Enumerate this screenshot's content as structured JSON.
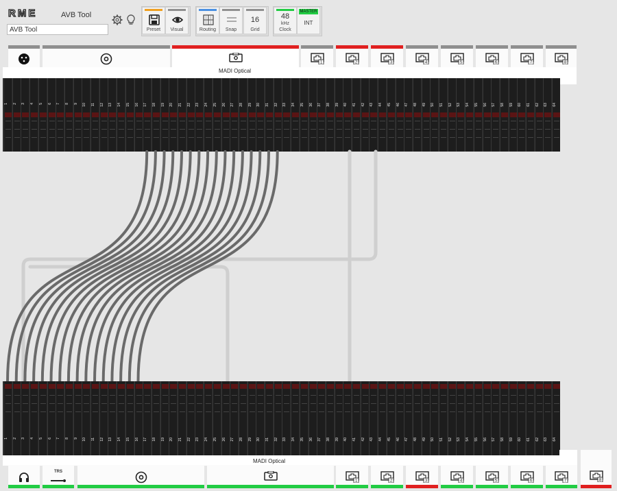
{
  "app": {
    "logo_text": "RME",
    "title": "AVB Tool",
    "device_name": "AVB Tool"
  },
  "toolbar": {
    "preset": {
      "label": "Preset",
      "color": "#f0a020"
    },
    "visual": {
      "label": "Visual",
      "color": "#909090"
    },
    "routing": {
      "label": "Routing",
      "color": "#4a90e2"
    },
    "snap": {
      "label": "Snap",
      "color": "#909090"
    },
    "grid": {
      "label": "Grid",
      "value": "16",
      "color": "#909090"
    },
    "clock": {
      "label": "Clock",
      "value": "48",
      "unit": "kHz",
      "color": "#22cc44"
    },
    "master": {
      "badge": "MASTER",
      "value": "INT",
      "color": "#22cc44"
    }
  },
  "top_tabs": [
    {
      "icon": "xlr-icon",
      "status": "#8f8f8f"
    },
    {
      "icon": "coax-icon",
      "status": "#8f8f8f"
    },
    {
      "icon": "optical-icon",
      "status": "#e02020",
      "selected": true
    },
    {
      "icon": "network-icon",
      "num": "1",
      "status": "#8f8f8f"
    },
    {
      "icon": "network-icon",
      "num": "2",
      "status": "#e02020"
    },
    {
      "icon": "network-icon",
      "num": "3",
      "status": "#e02020"
    },
    {
      "icon": "network-icon",
      "num": "4",
      "status": "#8f8f8f"
    },
    {
      "icon": "network-icon",
      "num": "5",
      "status": "#8f8f8f"
    },
    {
      "icon": "network-icon",
      "num": "6",
      "status": "#8f8f8f"
    },
    {
      "icon": "network-icon",
      "num": "7",
      "status": "#8f8f8f"
    },
    {
      "icon": "network-icon",
      "num": "8",
      "status": "#8f8f8f"
    }
  ],
  "top_label": "MADI Optical",
  "bottom_label": "MADI Optical",
  "bottom_tabs": [
    {
      "icon": "headphones-icon",
      "status": "#22cc44"
    },
    {
      "icon": "trs-icon",
      "text": "TRS",
      "status": "#22cc44"
    },
    {
      "icon": "coax-icon",
      "status": "#22cc44"
    },
    {
      "icon": "optical-icon",
      "status": "#22cc44",
      "selected": true
    },
    {
      "icon": "network-icon",
      "num": "1",
      "status": "#22cc44"
    },
    {
      "icon": "network-icon",
      "num": "2",
      "status": "#22cc44"
    },
    {
      "icon": "network-icon",
      "num": "3",
      "status": "#e02020"
    },
    {
      "icon": "network-icon",
      "num": "4",
      "status": "#22cc44"
    },
    {
      "icon": "network-icon",
      "num": "5",
      "status": "#22cc44"
    },
    {
      "icon": "network-icon",
      "num": "6",
      "status": "#22cc44"
    },
    {
      "icon": "network-icon",
      "num": "7",
      "status": "#22cc44"
    },
    {
      "icon": "network-icon",
      "num": "8",
      "status": "#e02020"
    }
  ],
  "channels": [
    "1",
    "2",
    "3",
    "4",
    "5",
    "6",
    "7",
    "8",
    "9",
    "10",
    "11",
    "12",
    "13",
    "14",
    "15",
    "16",
    "17",
    "18",
    "19",
    "20",
    "21",
    "22",
    "23",
    "24",
    "25",
    "26",
    "27",
    "28",
    "29",
    "30",
    "31",
    "32",
    "33",
    "34",
    "35",
    "36",
    "37",
    "38",
    "39",
    "40",
    "41",
    "42",
    "43",
    "44",
    "45",
    "46",
    "47",
    "48",
    "49",
    "50",
    "51",
    "52",
    "53",
    "54",
    "55",
    "56",
    "57",
    "58",
    "59",
    "60",
    "61",
    "62",
    "63",
    "64"
  ],
  "routes": [
    {
      "from": 17,
      "to": 1
    },
    {
      "from": 18,
      "to": 2
    },
    {
      "from": 19,
      "to": 3
    },
    {
      "from": 20,
      "to": 4
    },
    {
      "from": 21,
      "to": 5
    },
    {
      "from": 22,
      "to": 6
    },
    {
      "from": 23,
      "to": 7
    },
    {
      "from": 24,
      "to": 8
    },
    {
      "from": 25,
      "to": 9
    },
    {
      "from": 26,
      "to": 10
    },
    {
      "from": 27,
      "to": 11
    },
    {
      "from": 28,
      "to": 12
    },
    {
      "from": 29,
      "to": 13
    },
    {
      "from": 30,
      "to": 14
    },
    {
      "from": 31,
      "to": 15
    },
    {
      "from": 32,
      "to": 16
    }
  ],
  "colors": {
    "accent_red": "#e02020",
    "accent_green": "#22cc44",
    "accent_blue": "#4a90e2"
  }
}
